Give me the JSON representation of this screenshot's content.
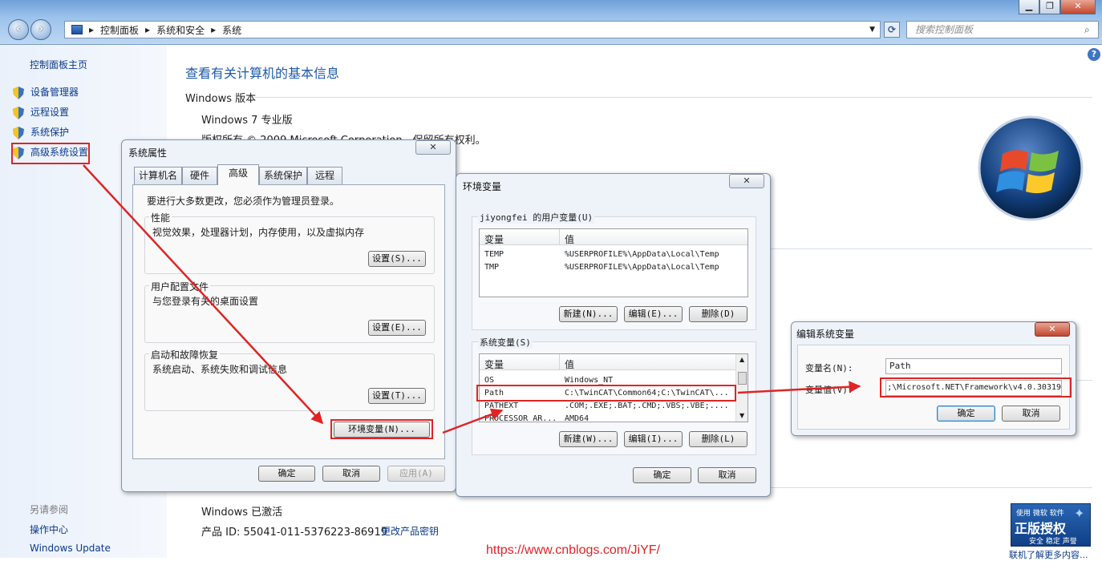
{
  "explorer": {
    "breadcrumb": [
      "控制面板",
      "系统和安全",
      "系统"
    ],
    "search_placeholder": "搜索控制面板",
    "window_buttons": [
      "▁",
      "❐",
      "✕"
    ]
  },
  "left_pane": {
    "home": "控制面板主页",
    "items": [
      {
        "label": "设备管理器"
      },
      {
        "label": "远程设置"
      },
      {
        "label": "系统保护"
      },
      {
        "label": "高级系统设置"
      }
    ],
    "see_also_title": "另请参阅",
    "see_also": [
      "操作中心",
      "Windows Update"
    ]
  },
  "main": {
    "title": "查看有关计算机的基本信息",
    "edition_section": "Windows 版本",
    "edition": "Windows 7 专业版",
    "copyright": "版权所有 © 2009 Microsoft Corporation。保留所有权利。",
    "activation": "Windows 已激活",
    "product_id_label": "产品 ID:",
    "product_id": "55041-011-5376223-86919",
    "change_key": "更改产品密钥",
    "genuine_line1": "使用 微软 软件",
    "genuine_line2": "正版授权",
    "genuine_line3": "安全 稳定 声誉",
    "learn_more": "联机了解更多内容..."
  },
  "sys_props": {
    "title": "系统属性",
    "close": "✕",
    "tabs": [
      "计算机名",
      "硬件",
      "高级",
      "系统保护",
      "远程"
    ],
    "admin_note": "要进行大多数更改，您必须作为管理员登录。",
    "perf_title": "性能",
    "perf_desc": "视觉效果，处理器计划，内存使用，以及虚拟内存",
    "perf_btn": "设置(S)...",
    "profile_title": "用户配置文件",
    "profile_desc": "与您登录有关的桌面设置",
    "profile_btn": "设置(E)...",
    "startup_title": "启动和故障恢复",
    "startup_desc": "系统启动、系统失败和调试信息",
    "startup_btn": "设置(T)...",
    "env_btn": "环境变量(N)...",
    "ok": "确定",
    "cancel": "取消",
    "apply": "应用(A)"
  },
  "env_vars": {
    "title": "环境变量",
    "close": "✕",
    "user_group": "jiyongfei 的用户变量(U)",
    "col_var": "变量",
    "col_val": "值",
    "user_rows": [
      {
        "name": "TEMP",
        "value": "%USERPROFILE%\\AppData\\Local\\Temp"
      },
      {
        "name": "TMP",
        "value": "%USERPROFILE%\\AppData\\Local\\Temp"
      }
    ],
    "sys_group": "系统变量(S)",
    "sys_rows": [
      {
        "name": "OS",
        "value": "Windows_NT"
      },
      {
        "name": "Path",
        "value": "C:\\TwinCAT\\Common64;C:\\TwinCAT\\..."
      },
      {
        "name": "PATHEXT",
        "value": ".COM;.EXE;.BAT;.CMD;.VBS;.VBE;...."
      },
      {
        "name": "PROCESSOR_AR...",
        "value": "AMD64"
      }
    ],
    "new_user": "新建(N)...",
    "edit_user": "编辑(E)...",
    "delete_user": "删除(D)",
    "new_sys": "新建(W)...",
    "edit_sys": "编辑(I)...",
    "delete_sys": "删除(L)",
    "ok": "确定",
    "cancel": "取消"
  },
  "edit_var": {
    "title": "编辑系统变量",
    "close": "✕",
    "name_label": "变量名(N):",
    "name_value": "Path",
    "value_label": "变量值(V):",
    "value_value": ";\\Microsoft.NET\\Framework\\v4.0.30319",
    "ok": "确定",
    "cancel": "取消"
  },
  "watermark": "https://www.cnblogs.com/JiYF/",
  "colors": {
    "annotation": "#e02424",
    "link": "#0b3a8a",
    "title_blue": "#1e5aa8"
  }
}
